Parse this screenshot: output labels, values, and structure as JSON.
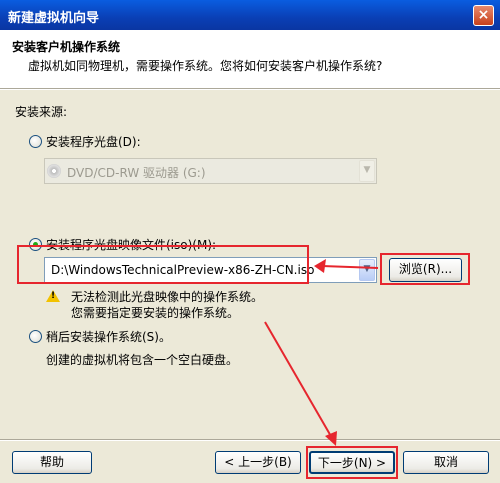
{
  "window": {
    "title": "新建虚拟机向导",
    "close_symbol": "×"
  },
  "header": {
    "title": "安装客户机操作系统",
    "subtitle": "虚拟机如同物理机，需要操作系统。您将如何安装客户机操作系统?"
  },
  "source_label": "安装来源:",
  "options": {
    "disc": {
      "label": "安装程序光盘(D):",
      "drive": "DVD/CD-RW 驱动器 (G:)"
    },
    "iso": {
      "label": "安装程序光盘映像文件(iso)(M):",
      "path": "D:\\WindowsTechnicalPreview-x86-ZH-CN.iso",
      "browse_label": "浏览(R)...",
      "warning_line1": "无法检测此光盘映像中的操作系统。",
      "warning_line2": "您需要指定要安装的操作系统。"
    },
    "later": {
      "label": "稍后安装操作系统(S)。",
      "description": "创建的虚拟机将包含一个空白硬盘。"
    }
  },
  "selected_option": "iso",
  "buttons": {
    "help": "帮助",
    "back": "< 上一步(B)",
    "next": "下一步(N) >",
    "cancel": "取消"
  },
  "annotation_color": "#e6262e"
}
